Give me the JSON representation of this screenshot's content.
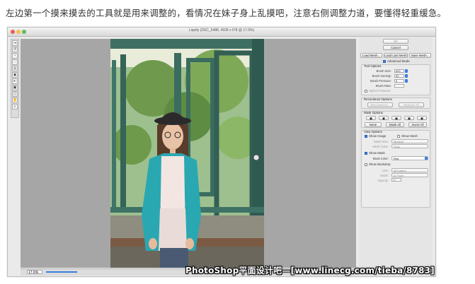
{
  "caption": "左边第一个摸来摸去的工具就是用来调整的，看情况在妹子身上乱摸吧，注意右侧调整力道，要懂得轻重缓急。",
  "window": {
    "title": "Liquify (DSC_5488, 4928 x 6*8 @ 17.6%)",
    "zoom": "17.6%",
    "traffic_colors": [
      "#ee5c54",
      "#f5be4f",
      "#5ac05a"
    ]
  },
  "panel": {
    "ok_label": "OK",
    "cancel_label": "Cancel",
    "load_mesh": "Load Mesh...",
    "load_last_mesh": "Load Last Mesh",
    "save_mesh": "Save Mesh...",
    "advanced_mode": "Advanced Mode",
    "tool_options": {
      "title": "Tool Options",
      "brush_size_label": "Brush Size:",
      "brush_size": "600",
      "brush_density_label": "Brush Density:",
      "brush_density": "50",
      "brush_pressure_label": "Brush Pressure:",
      "brush_pressure": "5",
      "brush_rate_label": "Brush Rate:",
      "stylus_pressure": "Stylus Pressure"
    },
    "reconstruct": {
      "title": "Reconstruct Options",
      "reconstruct_btn": "Reconstruct...",
      "restore_all_btn": "Restore All"
    },
    "mask": {
      "title": "Mask Options",
      "none_btn": "None",
      "mask_all_btn": "Mask All",
      "invert_all_btn": "Invert All"
    },
    "view": {
      "title": "View Options",
      "show_image": "Show Image",
      "show_mesh": "Show Mesh",
      "mesh_size_label": "Mesh Size:",
      "mesh_size": "Medium",
      "mesh_color_label": "Mesh Color:",
      "mesh_color": "Gray",
      "show_mask": "Show Mask",
      "mask_color_label": "Mask Color:",
      "mask_color": "Red",
      "show_backdrop": "Show Backdrop",
      "use_label": "Use:",
      "use_value": "All Layers",
      "mode_label": "Mode:",
      "mode_value": "In Front",
      "opacity_label": "Opacity:",
      "opacity_value": "50"
    },
    "accent": "#3d7ee0"
  },
  "watermark": "PhotoShop平面设计吧—[www.linecg.com/tieba/8783]"
}
